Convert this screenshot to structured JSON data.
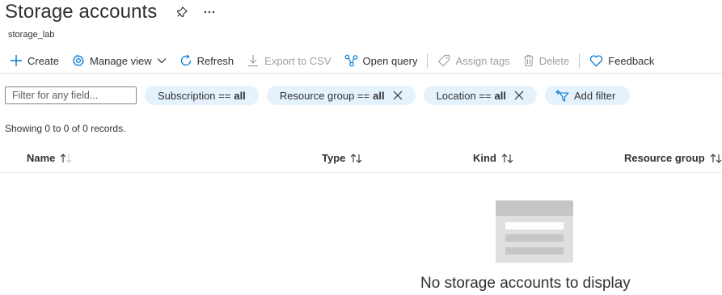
{
  "header": {
    "title": "Storage accounts",
    "subtitle": "storage_lab"
  },
  "toolbar": {
    "create": "Create",
    "manage_view": "Manage view",
    "refresh": "Refresh",
    "export_csv": "Export to CSV",
    "open_query": "Open query",
    "assign_tags": "Assign tags",
    "delete": "Delete",
    "feedback": "Feedback"
  },
  "filters": {
    "placeholder": "Filter for any field...",
    "subscription": {
      "label": "Subscription ==",
      "value": "all"
    },
    "resource_group": {
      "label": "Resource group ==",
      "value": "all"
    },
    "location": {
      "label": "Location ==",
      "value": "all"
    },
    "add_filter": "Add filter"
  },
  "records_text": "Showing 0 to 0 of 0 records.",
  "table": {
    "columns": [
      "Name",
      "Type",
      "Kind",
      "Resource group"
    ]
  },
  "empty_state": {
    "message": "No storage accounts to display"
  },
  "colors": {
    "accent": "#0078d4",
    "pill_bg": "#e5f1fb",
    "disabled": "#a19f9d"
  }
}
